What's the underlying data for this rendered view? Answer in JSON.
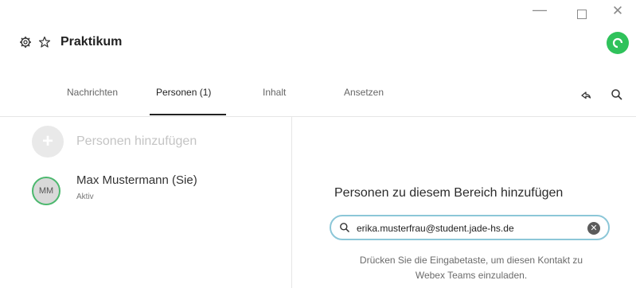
{
  "window": {
    "minimize_glyph": "—",
    "close_glyph": "✕"
  },
  "header": {
    "icons": [
      "gear-icon",
      "star-icon"
    ],
    "title": "Praktikum"
  },
  "tabs": [
    {
      "label": "Nachrichten",
      "active": false
    },
    {
      "label": "Personen (1)",
      "active": true
    },
    {
      "label": "Inhalt",
      "active": false
    },
    {
      "label": "Ansetzen",
      "active": false
    }
  ],
  "toolbar_icons": [
    "share-icon",
    "search-icon"
  ],
  "people": {
    "add_label": "Personen hinzufügen",
    "members": [
      {
        "initials": "MM",
        "name": "Max Mustermann (Sie)",
        "status": "Aktiv"
      }
    ]
  },
  "add_panel": {
    "heading": "Personen zu diesem Bereich hinzufügen",
    "search_value": "erika.musterfrau@student.jade-hs.de",
    "hint_line1": "Drücken Sie die Eingabetaste, um diesen Kontakt zu",
    "hint_line2": "Webex Teams einzuladen."
  },
  "colors": {
    "presence_green": "#2fc25b",
    "field_border": "#8cc7d8",
    "avatar_ring": "#4cb86e"
  }
}
